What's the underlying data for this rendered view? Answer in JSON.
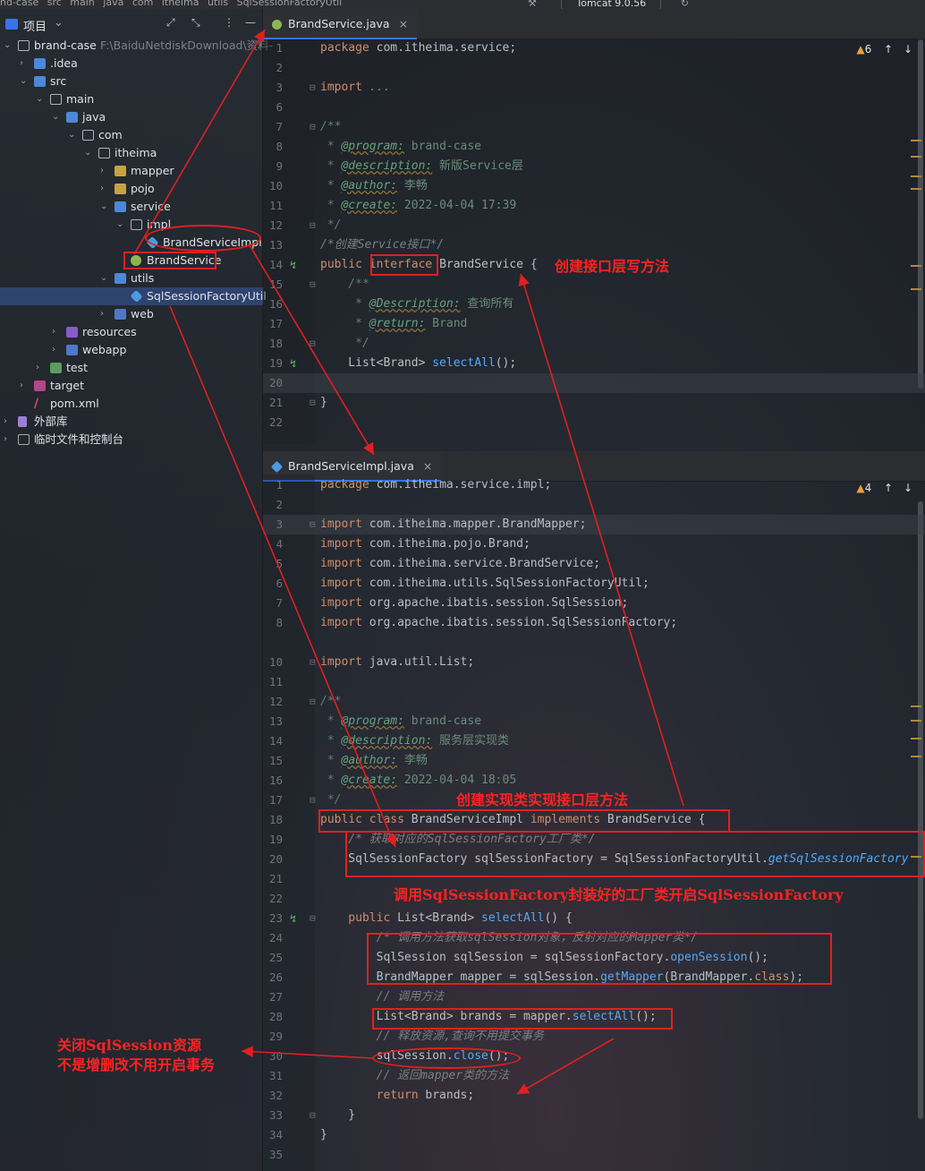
{
  "breadcrumb": {
    "items": [
      "nd-case",
      "src",
      "main",
      "java",
      "com",
      "itheima",
      "utils",
      "SqlSessionFactoryUtil"
    ],
    "run_config": "Tomcat 9.0.56"
  },
  "project": {
    "title": "项目",
    "tree": [
      {
        "label": "brand-case",
        "sub": "F:\\BaiduNetdiskDownload\\资料-",
        "icon": "folder",
        "arrow": "v"
      },
      {
        "label": ".idea",
        "icon": "folder-blue",
        "arrow": ">"
      },
      {
        "label": "src",
        "icon": "folder-blue",
        "arrow": "v"
      },
      {
        "label": "main",
        "icon": "folder",
        "arrow": "v"
      },
      {
        "label": "java",
        "icon": "folder-blue",
        "arrow": "v"
      },
      {
        "label": "com",
        "icon": "folder",
        "arrow": "v"
      },
      {
        "label": "itheima",
        "icon": "folder",
        "arrow": "v"
      },
      {
        "label": "mapper",
        "icon": "folder-yellow",
        "arrow": ">"
      },
      {
        "label": "pojo",
        "icon": "folder-yellow",
        "arrow": ">"
      },
      {
        "label": "service",
        "icon": "folder-blue",
        "arrow": "v"
      },
      {
        "label": "impl",
        "icon": "folder",
        "arrow": "v"
      },
      {
        "label": "BrandServiceImpl",
        "icon": "class"
      },
      {
        "label": "BrandService",
        "icon": "interface"
      },
      {
        "label": "utils",
        "icon": "folder-blue",
        "arrow": "v"
      },
      {
        "label": "SqlSessionFactoryUtil",
        "icon": "class"
      },
      {
        "label": "web",
        "icon": "folder-web",
        "arrow": ">"
      },
      {
        "label": "resources",
        "icon": "folder-res",
        "arrow": ">"
      },
      {
        "label": "webapp",
        "icon": "folder-web",
        "arrow": ">"
      },
      {
        "label": "test",
        "icon": "folder-test",
        "arrow": ">"
      },
      {
        "label": "target",
        "icon": "folder-pink",
        "arrow": ">"
      },
      {
        "label": "pom.xml",
        "icon": "xml"
      },
      {
        "label": "外部库",
        "icon": "lib",
        "arrow": ">"
      },
      {
        "label": "临时文件和控制台",
        "icon": "scratch",
        "arrow": ">"
      }
    ]
  },
  "editor1": {
    "tab": "BrandService.java",
    "warnings": "6",
    "lines": [
      "1",
      "2",
      "3",
      "6",
      "7",
      "8",
      "9",
      "10",
      "11",
      "12",
      "13",
      "14",
      "15",
      "16",
      "17",
      "18",
      "19",
      "20",
      "21",
      "22"
    ]
  },
  "editor2": {
    "tab": "BrandServiceImpl.java",
    "warnings": "4",
    "lines": [
      "1",
      "2",
      "3",
      "4",
      "5",
      "6",
      "7",
      "8",
      "10",
      "11",
      "12",
      "13",
      "14",
      "15",
      "16",
      "17",
      "18",
      "19",
      "20",
      "21",
      "22",
      "23",
      "24",
      "25",
      "26",
      "27",
      "28",
      "29",
      "30",
      "31",
      "32",
      "33",
      "34",
      "35"
    ]
  },
  "code1": {
    "l1_kw": "package",
    "l1_rest": " com.itheima.service;",
    "l3_kw": "import",
    "l3_rest": " ...",
    "l7": "/**",
    "l8_tag": "@program:",
    "l8_val": " brand-case",
    "l9_tag": "@description:",
    "l9_val": " 新版Service层",
    "l10_tag": "@author:",
    "l10_val": " 李畅",
    "l11_tag": "@create:",
    "l11_val": " 2022-04-04 17:39",
    "l12": " */",
    "l13": "/*创建Service接口*/",
    "l14_kw": "public",
    "l14_kw2": "interface",
    "l14_rest": " BrandService {",
    "l15": "    /**",
    "l16_tag": "@Description:",
    "l16_val": " 查询所有",
    "l17_tag": "@return:",
    "l17_val": " Brand",
    "l18": "     */",
    "l19_type": "    List<Brand> ",
    "l19_fn": "selectAll",
    "l19_rest": "();",
    "l21": "}"
  },
  "code2": {
    "l1_kw": "package",
    "l1_rest": " com.itheima.service.impl;",
    "imports": [
      "com.itheima.mapper.BrandMapper;",
      "com.itheima.pojo.Brand;",
      "com.itheima.service.BrandService;",
      "com.itheima.utils.SqlSessionFactoryUtil;",
      "org.apache.ibatis.session.SqlSession;",
      "org.apache.ibatis.session.SqlSessionFactory;"
    ],
    "import_kw": "import",
    "l10_rest": " java.util.List;",
    "l12": "/**",
    "l13_tag": "@program:",
    "l13_val": " brand-case",
    "l14_tag": "@description:",
    "l14_val": " 服务层实现类",
    "l15_tag": "@author:",
    "l15_val": " 李畅",
    "l16_tag": "@create:",
    "l16_val": " 2022-04-04 18:05",
    "l17": " */",
    "l18_kw": "public",
    "l18_kw2": "class",
    "l18_mid": " BrandServiceImpl ",
    "l18_kw3": "implements",
    "l18_rest": " BrandService {",
    "l19": "    /* 获取对应的SqlSessionFactory工厂类*/",
    "l20_a": "    SqlSessionFactory sqlSessionFactory = SqlSessionFactoryUtil.",
    "l20_fn": "getSqlSessionFactory",
    "l23_kw": "    public",
    "l23_type": " List<Brand> ",
    "l23_fn": "selectAll",
    "l23_rest": "() {",
    "l24": "        /* 调用方法获取sqlSession对象，反射对应的Mapper类*/",
    "l25_a": "        SqlSession sqlSession = sqlSessionFactory.",
    "l25_fn": "openSession",
    "l25_rest": "();",
    "l26_a": "        BrandMapper mapper = sqlSession.",
    "l26_fn": "getMapper",
    "l26_b": "(BrandMapper.",
    "l26_kw": "class",
    "l26_rest": ");",
    "l27": "        // 调用方法",
    "l28_a": "        List<Brand> brands = mapper.",
    "l28_fn": "selectAll",
    "l28_rest": "();",
    "l29": "        // 释放资源,查询不用提交事务",
    "l30_a": "        sqlSession.",
    "l30_fn": "close",
    "l30_rest": "();",
    "l31": "        // 返回mapper类的方法",
    "l32_kw": "        return",
    "l32_rest": " brands;",
    "l33": "    }",
    "l34": "}"
  },
  "annotations": {
    "a1": "创建接口层写方法",
    "a2": "创建实现类实现接口层方法",
    "a3": "调用SqlSessionFactory封装好的工厂类开启SqlSessionFactory",
    "a4_line1": "关闭SqlSession资源",
    "a4_line2": "不是增删改不用开启事务"
  }
}
